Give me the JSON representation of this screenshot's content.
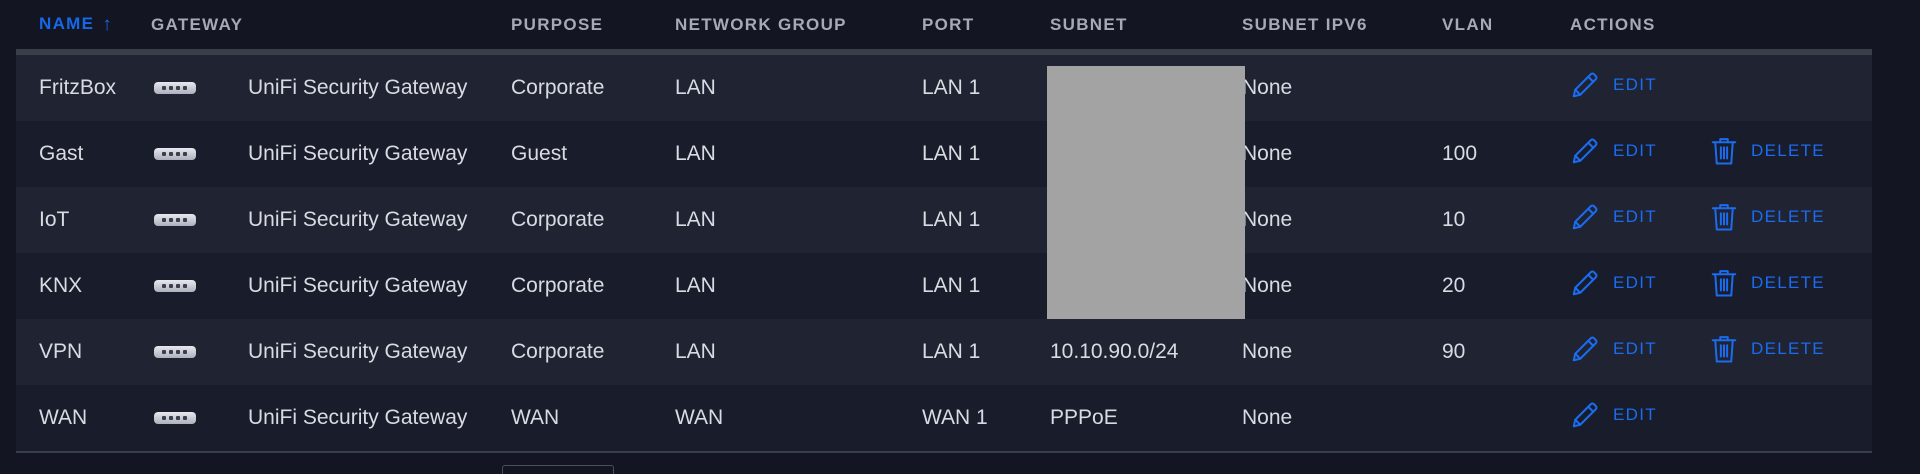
{
  "columns": {
    "name": "NAME",
    "gateway": "GATEWAY",
    "purpose": "PURPOSE",
    "network_group": "NETWORK GROUP",
    "port": "PORT",
    "subnet": "SUBNET",
    "subnet_ipv6": "SUBNET IPV6",
    "vlan": "VLAN",
    "actions": "ACTIONS",
    "sort_arrow": "↑"
  },
  "rows": [
    {
      "name": "FritzBox",
      "gateway": "UniFi Security Gateway",
      "purpose": "Corporate",
      "network_group": "LAN",
      "port": "LAN 1",
      "subnet": "",
      "subnet_ipv6": "None",
      "vlan": "",
      "edit": "EDIT",
      "delete": ""
    },
    {
      "name": "Gast",
      "gateway": "UniFi Security Gateway",
      "purpose": "Guest",
      "network_group": "LAN",
      "port": "LAN 1",
      "subnet": "",
      "subnet_ipv6": "None",
      "vlan": "100",
      "edit": "EDIT",
      "delete": "DELETE"
    },
    {
      "name": "IoT",
      "gateway": "UniFi Security Gateway",
      "purpose": "Corporate",
      "network_group": "LAN",
      "port": "LAN 1",
      "subnet": "",
      "subnet_ipv6": "None",
      "vlan": "10",
      "edit": "EDIT",
      "delete": "DELETE"
    },
    {
      "name": "KNX",
      "gateway": "UniFi Security Gateway",
      "purpose": "Corporate",
      "network_group": "LAN",
      "port": "LAN 1",
      "subnet": "",
      "subnet_ipv6": "None",
      "vlan": "20",
      "edit": "EDIT",
      "delete": "DELETE"
    },
    {
      "name": "VPN",
      "gateway": "UniFi Security Gateway",
      "purpose": "Corporate",
      "network_group": "LAN",
      "port": "LAN 1",
      "subnet": "10.10.90.0/24",
      "subnet_ipv6": "None",
      "vlan": "90",
      "edit": "EDIT",
      "delete": "DELETE"
    },
    {
      "name": "WAN",
      "gateway": "UniFi Security Gateway",
      "purpose": "WAN",
      "network_group": "WAN",
      "port": "WAN 1",
      "subnet": "PPPoE",
      "subnet_ipv6": "None",
      "vlan": "",
      "edit": "EDIT",
      "delete": ""
    }
  ],
  "colors": {
    "background": "#131522",
    "accent": "#1668e8",
    "row_odd": "#202332",
    "row_even": "#191c2a",
    "redaction": "#a3a3a3"
  },
  "icons": {
    "gateway": "gateway-device-icon",
    "edit": "pencil-icon",
    "delete": "trash-icon"
  }
}
